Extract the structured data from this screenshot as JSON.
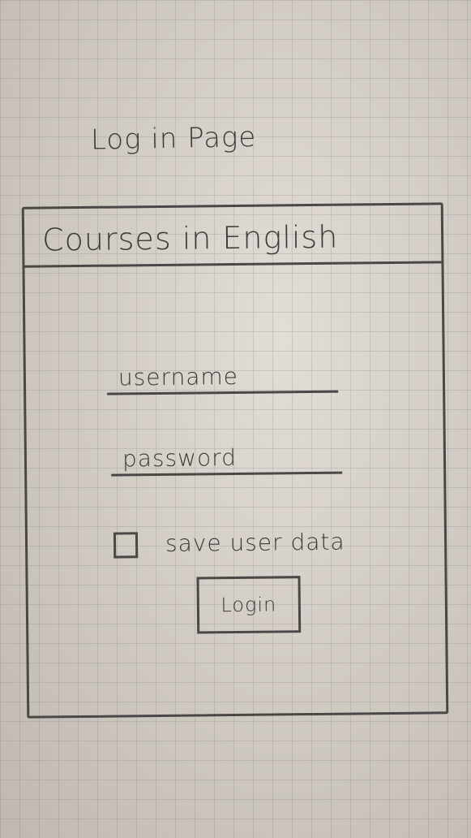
{
  "page": {
    "heading": "Log in Page"
  },
  "app": {
    "title": "Courses in English"
  },
  "form": {
    "username_placeholder": "username",
    "password_placeholder": "password",
    "remember_label": "save user data",
    "login_label": "Login"
  }
}
